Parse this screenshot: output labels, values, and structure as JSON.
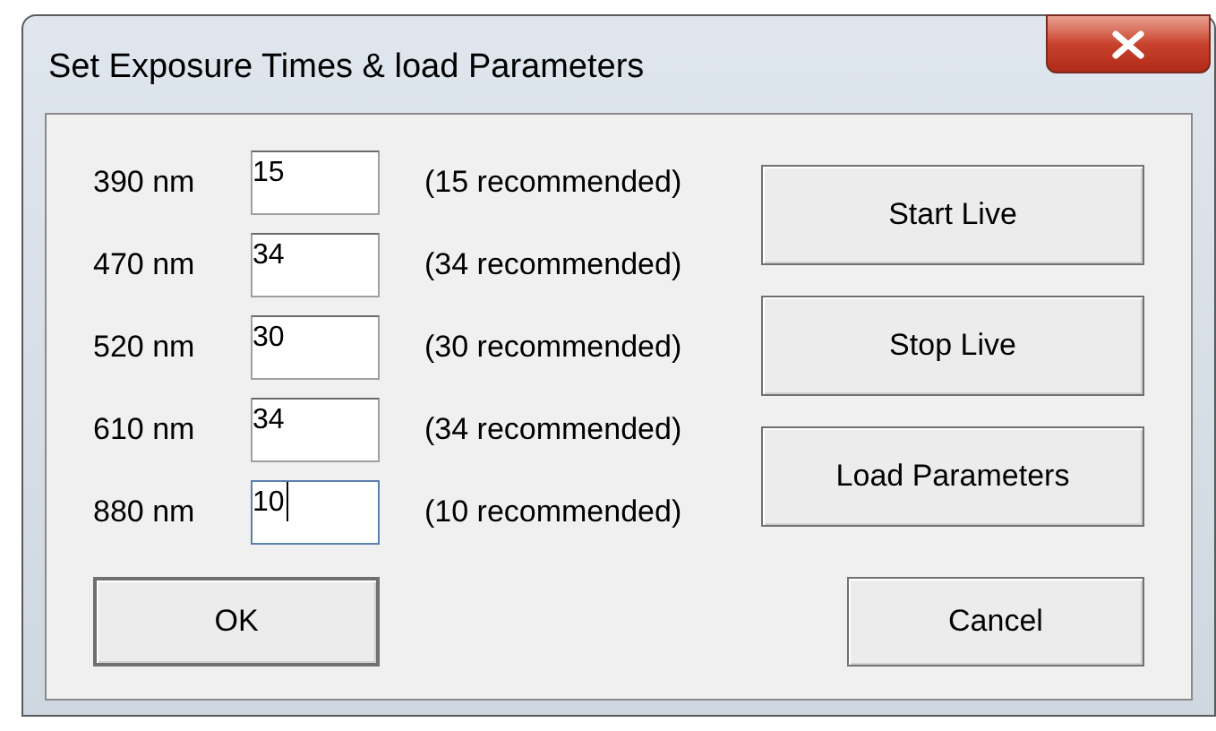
{
  "window": {
    "title": "Set Exposure Times & load Parameters"
  },
  "rows": [
    {
      "label": "390 nm",
      "value": "15",
      "hint": "(15 recommended)",
      "focused": false
    },
    {
      "label": "470 nm",
      "value": "34",
      "hint": "(34 recommended)",
      "focused": false
    },
    {
      "label": "520 nm",
      "value": "30",
      "hint": "(30 recommended)",
      "focused": false
    },
    {
      "label": "610 nm",
      "value": "34",
      "hint": "(34 recommended)",
      "focused": false
    },
    {
      "label": "880 nm",
      "value": "10",
      "hint": "(10 recommended)",
      "focused": true
    }
  ],
  "side_buttons": [
    "Start Live",
    "Stop Live",
    "Load Parameters"
  ],
  "ok_button": "OK",
  "cancel_button": "Cancel"
}
